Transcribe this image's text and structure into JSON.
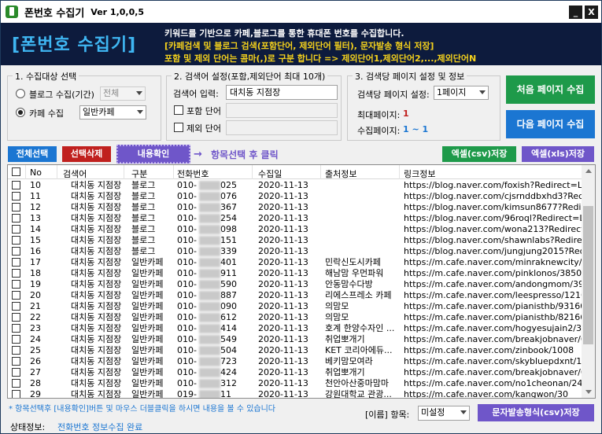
{
  "window": {
    "title": "폰번호 수집기",
    "version": "Ver 1,0,0,5",
    "minimize": "_",
    "close": "X"
  },
  "banner": {
    "logo": "[폰번호 수집기]",
    "line1": "키워드를 기반으로 카페,블로그를 통한 휴대폰 번호를 수집합니다.",
    "line2": "[카페검색 및 블로그 검색(포함단어, 제외단어 필터), 문자발송 형식 저장]",
    "line3": "포함 및 제외 단어는 콤마(,)로 구분 합니다 => 제외단어1,제외단어2,...,제외단어N"
  },
  "group1": {
    "title": "1. 수집대상 선택",
    "blog_label": "블로그 수집(기간)",
    "blog_select": "전체",
    "cafe_label": "카페 수집",
    "cafe_select": "일반카페"
  },
  "group2": {
    "title": "2. 검색어 설정(포함,제외단어 최대 10개)",
    "keyword_label": "검색어 입력:",
    "keyword_value": "대치동 지점장",
    "include_label": "포함 단어",
    "exclude_label": "제외 단어"
  },
  "group3": {
    "title": "3. 검색당 페이지 설정 및 정보",
    "page_setting_label": "검색당 페이지 설정:",
    "page_setting_value": "1페이지",
    "max_page_label": "최대페이지:",
    "max_page_value": "1",
    "collect_page_label": "수집페이지:",
    "collect_page_value": "1 ~ 1"
  },
  "buttons": {
    "first_page": "처음 페이지 수집",
    "next_page": "다음 페이지 수집",
    "select_all": "전체선택",
    "delete_selected": "선택삭제",
    "view_content": "내용확인",
    "hint": "항목선택 후 클릭",
    "excel_csv": "엑셀(csv)저장",
    "excel_xls": "엑셀(xls)저장",
    "sms_csv": "문자발송형식(csv)저장"
  },
  "table": {
    "headers": [
      "No",
      "검색어",
      "구분",
      "전화번호",
      "수집일",
      "출처정보",
      "링크정보"
    ],
    "rows": [
      [
        "10",
        "대치동 지점장",
        "블로그",
        "010-",
        "025",
        "2020-11-13",
        "",
        "https://blog.naver.com/foxish?Redirect=Lo..."
      ],
      [
        "11",
        "대치동 지점장",
        "블로그",
        "010-",
        "076",
        "2020-11-13",
        "",
        "https://blog.naver.com/cjsrnddbxhd3?Redi..."
      ],
      [
        "12",
        "대치동 지점장",
        "블로그",
        "010-",
        "367",
        "2020-11-13",
        "",
        "https://blog.naver.com/kimsun8677?Redire..."
      ],
      [
        "13",
        "대치동 지점장",
        "블로그",
        "010-",
        "254",
        "2020-11-13",
        "",
        "https://blog.naver.com/96roql?Redirect=Lo..."
      ],
      [
        "14",
        "대치동 지점장",
        "블로그",
        "010-",
        "098",
        "2020-11-13",
        "",
        "https://blog.naver.com/wona213?Redirect=L..."
      ],
      [
        "15",
        "대치동 지점장",
        "블로그",
        "010-",
        "151",
        "2020-11-13",
        "",
        "https://blog.naver.com/shawnlabs?Redire..."
      ],
      [
        "16",
        "대치동 지점장",
        "블로그",
        "010-",
        "339",
        "2020-11-13",
        "",
        "https://blog.naver.com/jungjung2015?Redi..."
      ],
      [
        "17",
        "대치동 지점장",
        "일반카페",
        "010-",
        "401",
        "2020-11-13",
        "민락신도시카페",
        "https://m.cafe.naver.com/minraknewcity/9..."
      ],
      [
        "18",
        "대치동 지점장",
        "일반카페",
        "010-",
        "911",
        "2020-11-13",
        "해남맘 우먼파워",
        "https://m.cafe.naver.com/pinklonos/38502"
      ],
      [
        "19",
        "대치동 지점장",
        "일반카페",
        "010-",
        "590",
        "2020-11-13",
        "안동맘수다방",
        "https://m.cafe.naver.com/andongmom/39..."
      ],
      [
        "20",
        "대치동 지점장",
        "일반카페",
        "010-",
        "887",
        "2020-11-13",
        "리에스프레소 카페",
        "https://m.cafe.naver.com/leespresso/12169"
      ],
      [
        "21",
        "대치동 지점장",
        "일반카페",
        "010-",
        "090",
        "2020-11-13",
        "의맘모",
        "https://m.cafe.naver.com/pianisthb/931602"
      ],
      [
        "22",
        "대치동 지점장",
        "일반카페",
        "010-",
        "612",
        "2020-11-13",
        "의맘모",
        "https://m.cafe.naver.com/pianisthb/821669"
      ],
      [
        "23",
        "대치동 지점장",
        "일반카페",
        "010-",
        "414",
        "2020-11-13",
        "호계 한양수자인 ...",
        "https://m.cafe.naver.com/hogyesujain2/3344"
      ],
      [
        "24",
        "대치동 지점장",
        "일반카페",
        "010-",
        "549",
        "2020-11-13",
        "취업뽀개기",
        "https://m.cafe.naver.com/breakjobnaver/6..."
      ],
      [
        "25",
        "대치동 지점장",
        "일반카페",
        "010-",
        "504",
        "2020-11-13",
        "KET 코리아에듀...",
        "https://m.cafe.naver.com/zinbook/1008"
      ],
      [
        "26",
        "대치동 지점장",
        "일반카페",
        "010-",
        "723",
        "2020-11-13",
        "베키맘모여라",
        "https://m.cafe.naver.com/skybluepdxnt/19..."
      ],
      [
        "27",
        "대치동 지점장",
        "일반카페",
        "010-",
        "424",
        "2020-11-13",
        "취업뽀개기",
        "https://m.cafe.naver.com/breakjobnaver/6..."
      ],
      [
        "28",
        "대치동 지점장",
        "일반카페",
        "010-",
        "312",
        "2020-11-13",
        "천안아산중마맘마",
        "https://m.cafe.naver.com/no1cheonan/246..."
      ],
      [
        "29",
        "대치동 지점장",
        "일반카페",
        "019-",
        "11",
        "2020-11-13",
        "강원대학교 관광...",
        "https://m.cafe.naver.com/kangwon/30"
      ]
    ]
  },
  "footer": {
    "note": "* 항목선택후 [내용확인]버튼 및 마우스 더블클릭을 하시면 내용을 볼 수 있습니다",
    "item_label": "[이름] 항목:",
    "item_select": "미설정",
    "status_label": "상태정보:",
    "status_value": "전화번호 정보수집 완료"
  },
  "colors": {
    "banner_bg": "#0d1b3d",
    "logo": "#3fb6f2",
    "yellow": "#f5d21c",
    "green": "#1e9a4a",
    "blue": "#1b76d2",
    "red": "#c0201e",
    "purple": "#6f56c9"
  }
}
